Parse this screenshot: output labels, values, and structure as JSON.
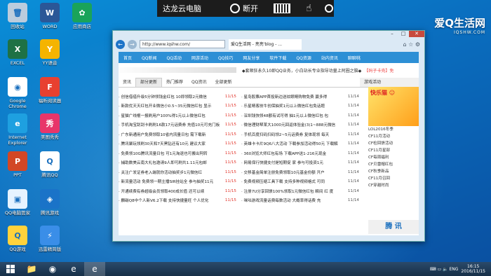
{
  "desktop": {
    "icons": [
      {
        "label": "回收站",
        "name": "recycle-bin-icon",
        "color": "#bcd",
        "glyph": "🗑"
      },
      {
        "label": "WORD",
        "name": "word-icon",
        "color": "#2b5797",
        "glyph": "W"
      },
      {
        "label": "应用商店",
        "name": "app-store-icon",
        "color": "#1aa35a",
        "glyph": "✿"
      },
      {
        "label": "EXCEL",
        "name": "excel-icon",
        "color": "#1e7145",
        "glyph": "X"
      },
      {
        "label": "YY语音",
        "name": "yy-voice-icon",
        "color": "#f5b400",
        "glyph": "Y"
      },
      {
        "label": "Google Chrome",
        "name": "chrome-icon",
        "color": "#ffffff",
        "glyph": "◉"
      },
      {
        "label": "福昕阅读器",
        "name": "foxit-reader-icon",
        "color": "#e84030",
        "glyph": "F"
      },
      {
        "label": "Internet Explorer",
        "name": "ie-icon",
        "color": "#1ea0e0",
        "glyph": "e"
      },
      {
        "label": "美图秀秀",
        "name": "meitu-icon",
        "color": "#e8356a",
        "glyph": "秀"
      },
      {
        "label": "PPT",
        "name": "ppt-icon",
        "color": "#d24726",
        "glyph": "P"
      },
      {
        "label": "腾讯QQ",
        "name": "qq-icon",
        "color": "#ffffff",
        "glyph": "Q"
      },
      {
        "label": "QQ电脑管家",
        "name": "qq-pc-manager-icon",
        "color": "#e6f3ff",
        "glyph": "▣"
      },
      {
        "label": "腾讯游戏",
        "name": "tencent-games-icon",
        "color": "#1a73c8",
        "glyph": "◈"
      },
      {
        "label": "QQ游戏",
        "name": "qq-games-icon",
        "color": "#ffd23c",
        "glyph": "Q"
      },
      {
        "label": "迅雷精简版",
        "name": "xunlei-icon",
        "color": "#3a8ee8",
        "glyph": "⚡"
      }
    ]
  },
  "remote_toolbar": {
    "pc_name": "达龙云电脑",
    "disconnect": "断开"
  },
  "logo": {
    "text": "爱Q生活网",
    "sub": "IQSHW.COM"
  },
  "browser": {
    "window_controls": {
      "minimize": "–",
      "maximize": "□",
      "close": "✕"
    },
    "url": "http://www.iqshw.com/",
    "tab_title": "爱Q生活网 - 亮亮'blog - ...",
    "nav": [
      "首页",
      "QQ新闻",
      "QQ活动",
      "网游活动",
      "QQ技巧",
      "网友分享",
      "软件下载",
      "QQ资源",
      "站内资讯",
      "聊聊桃"
    ],
    "marquee": "◆套顺狂永久10即QQ业务，小白站长专业指导功量上阿圈之脑◆",
    "marquee2": "【码子卡壳】免",
    "tabs": [
      "资讯",
      "部分更新",
      "热门推荐",
      "QQ资讯",
      "全部更新"
    ],
    "side_title": "游戏活动",
    "left_list": [
      {
        "t": "· 创信借借升级5分钟领钱金红包 10即领取2元微信",
        "d": "11/15"
      },
      {
        "t": "· 新款优天天红包开业微信小0.5~35元微信红包 显示",
        "d": "11/15"
      },
      {
        "t": "· 星猫广线棍一报刷用户100%得1元以上微信红包",
        "d": "11/15"
      },
      {
        "t": "· 手机淘宝刮刮卡刷刷16款17元话费券 充值10元可充门板",
        "d": "11/15"
      },
      {
        "t": "· 广东新通用户免费领取10省内流量日包 需下载新",
        "d": "11/15"
      },
      {
        "t": "· 腾讯聚玩领刷30天和7天黑钻还有10元 建议大家",
        "d": "11/15"
      },
      {
        "t": "· 免费领10G腾讯流量日包 可1元淘退也可搬出阿转",
        "d": "11/15"
      },
      {
        "t": "· 捕助数美云南大礼包邀请9人即可刷共1.11元包邮",
        "d": "11/15"
      },
      {
        "t": "· 关注广发证券老入端就你活动抽奖步1元微信红",
        "d": "11/15"
      },
      {
        "t": "· 新流量活动 免费领一期主播SIR挂站全 参与抽奖11元",
        "d": "11/15"
      },
      {
        "t": "· 开通续费有券超级会员领取400成长值 还可以续",
        "d": "11/15"
      },
      {
        "t": "· 麟碳Q8中个人新V6.2下载 支持快捷量旺 个人优化",
        "d": "11/15"
      }
    ],
    "right_list": [
      {
        "t": "· 星岛股票APP首投新边送纹眼睛购物免费 赢多得",
        "d": "11/14"
      },
      {
        "t": "· 乐星睛客技牛创保抽奖1元以上微信红包免话题",
        "d": "11/14"
      },
      {
        "t": "· 深圳钱快领48额有试可得 抽1元以上微信红包 包",
        "d": "11/14"
      },
      {
        "t": "· 微信理财帮某大1000元回返体验金(3)1~888元微信",
        "d": "11/14"
      },
      {
        "t": "· 手机百度扫码扫码领2~5元话费券 复体现领 每天",
        "d": "11/14"
      },
      {
        "t": "· 英雄卡卡片9Q6八大活动 下载参加活动得50元 下载解",
        "d": "11/14"
      },
      {
        "t": "· 360浏览大师红包有场 下载APP送1-216元现金",
        "d": "11/14"
      },
      {
        "t": "· 网易保行快捷支付是短期促 家 参与可投资1元",
        "d": "11/14"
      },
      {
        "t": "· 交移基金简单注册免费领取10元基金份额 开户",
        "d": "11/14"
      },
      {
        "t": "· 免费视频压缩工具下载 支持多种视频格式 可同",
        "d": "11/14"
      },
      {
        "t": "· 注册7U分享回馈100%领取1元微信红包 瞬间 红 度",
        "d": "11/14"
      },
      {
        "t": "· 咪咕游戏流量话费每数活动 大概率得话费 充",
        "d": "11/14"
      }
    ],
    "side_items": [
      "LOL2016冬季",
      "CF11月活动",
      "CF检回馈活动",
      "CF11月星部",
      "CF每周福利",
      "CF贝雷帽红包",
      "CF秋季新品",
      "CF11月召回",
      "CF穿越时尚"
    ],
    "side_ad": "腾 讯"
  },
  "taskbar": {
    "apps": [
      {
        "name": "file-explorer-icon",
        "glyph": "📁"
      },
      {
        "name": "chrome-taskbar-icon",
        "glyph": "◉"
      },
      {
        "name": "ie-taskbar-icon",
        "glyph": "e"
      },
      {
        "name": "ie-active-taskbar-icon",
        "glyph": "e"
      }
    ],
    "lang": "ENG",
    "time": "16:15",
    "date": "2016/11/15"
  }
}
